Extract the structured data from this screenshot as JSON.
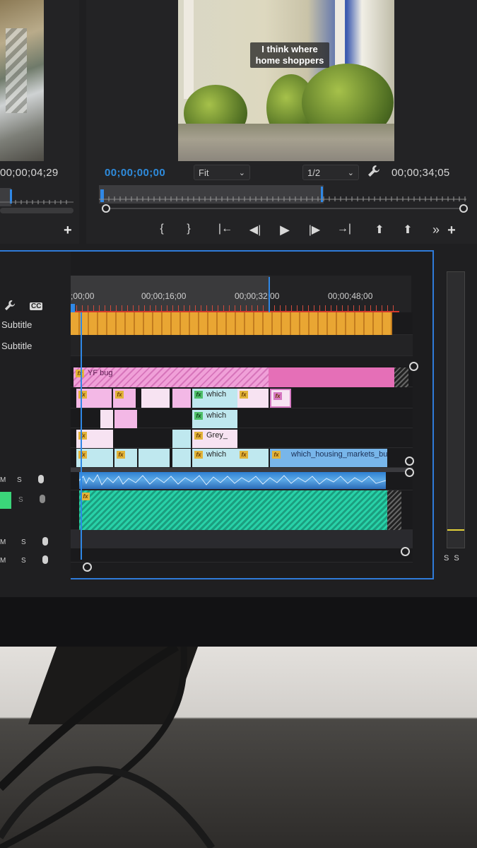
{
  "source_monitor": {
    "timecode": "00;00;04;29",
    "add_label": "+"
  },
  "program_monitor": {
    "caption": "I think where home shoppers",
    "timecode": "00;00;00;00",
    "fit": {
      "selected": "Fit"
    },
    "resolution": {
      "selected": "1/2"
    },
    "duration": "00;00;34;05",
    "transport": {
      "mark_in": "{",
      "mark_out": "}",
      "go_to_in": "|←",
      "step_back": "◀|",
      "play": "▶",
      "step_forward": "|▶",
      "go_to_out": "→|",
      "lift": "⬆",
      "extract": "⬆",
      "more": "»",
      "add": "+"
    },
    "icons": {
      "wrench": "wrench-icon"
    }
  },
  "timeline": {
    "ruler_labels": [
      ";00;00",
      "00;00;16;00",
      "00;00;32;00",
      "00;00;48;00"
    ],
    "tools": {
      "wrench": "🔧",
      "cc": "CC"
    },
    "tracks": [
      {
        "name": "Subtitle"
      },
      {
        "name": "Subtitle"
      }
    ],
    "audio_track_controls": [
      {
        "m": "M",
        "s": "S"
      },
      {
        "m": "",
        "s": "S"
      },
      {
        "m": "M",
        "s": "S"
      },
      {
        "m": "M",
        "s": "S"
      }
    ],
    "clips": {
      "v4_bug": "YF bug",
      "v3_which": "which",
      "v2_which": "which",
      "v2_grey": "Grey_",
      "v1_which": "which",
      "v1_long": "which_housing_markets_bu"
    },
    "fx_label": "fx"
  },
  "meter": {
    "ss_label": "S S"
  },
  "colors": {
    "accent_blue": "#2f7bd9",
    "subtitle_orange": "#e9a633",
    "pink": "#e56fb7",
    "light_blue": "#8fd6e6",
    "audio_blue": "#2d80d2",
    "audio_green": "#28d2a8"
  }
}
